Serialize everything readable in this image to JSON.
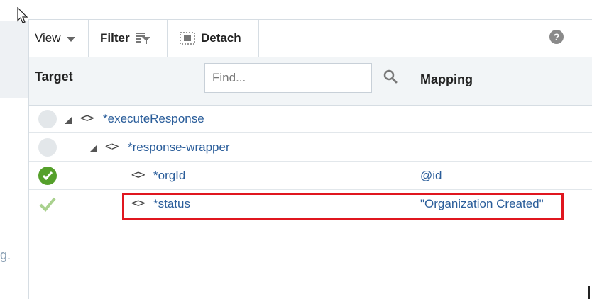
{
  "left_fragment": "g.",
  "toolbar": {
    "view_label": "View",
    "filter_label": "Filter",
    "detach_label": "Detach",
    "help_label": "?"
  },
  "header": {
    "target_label": "Target",
    "find_placeholder": "Find...",
    "mapping_label": "Mapping"
  },
  "rows": [
    {
      "name": "*executeResponse",
      "status": "none",
      "mapping": ""
    },
    {
      "name": "*response-wrapper",
      "status": "none",
      "mapping": ""
    },
    {
      "name": "*orgId",
      "status": "mapped",
      "mapping": "@id"
    },
    {
      "name": "*status",
      "status": "mapped-light",
      "mapping": "\"Organization Created\""
    }
  ],
  "colors": {
    "link": "#2a5d9a",
    "highlight": "#e0161f",
    "ok_green": "#55a02b",
    "ok_light": "#a9d18e"
  }
}
